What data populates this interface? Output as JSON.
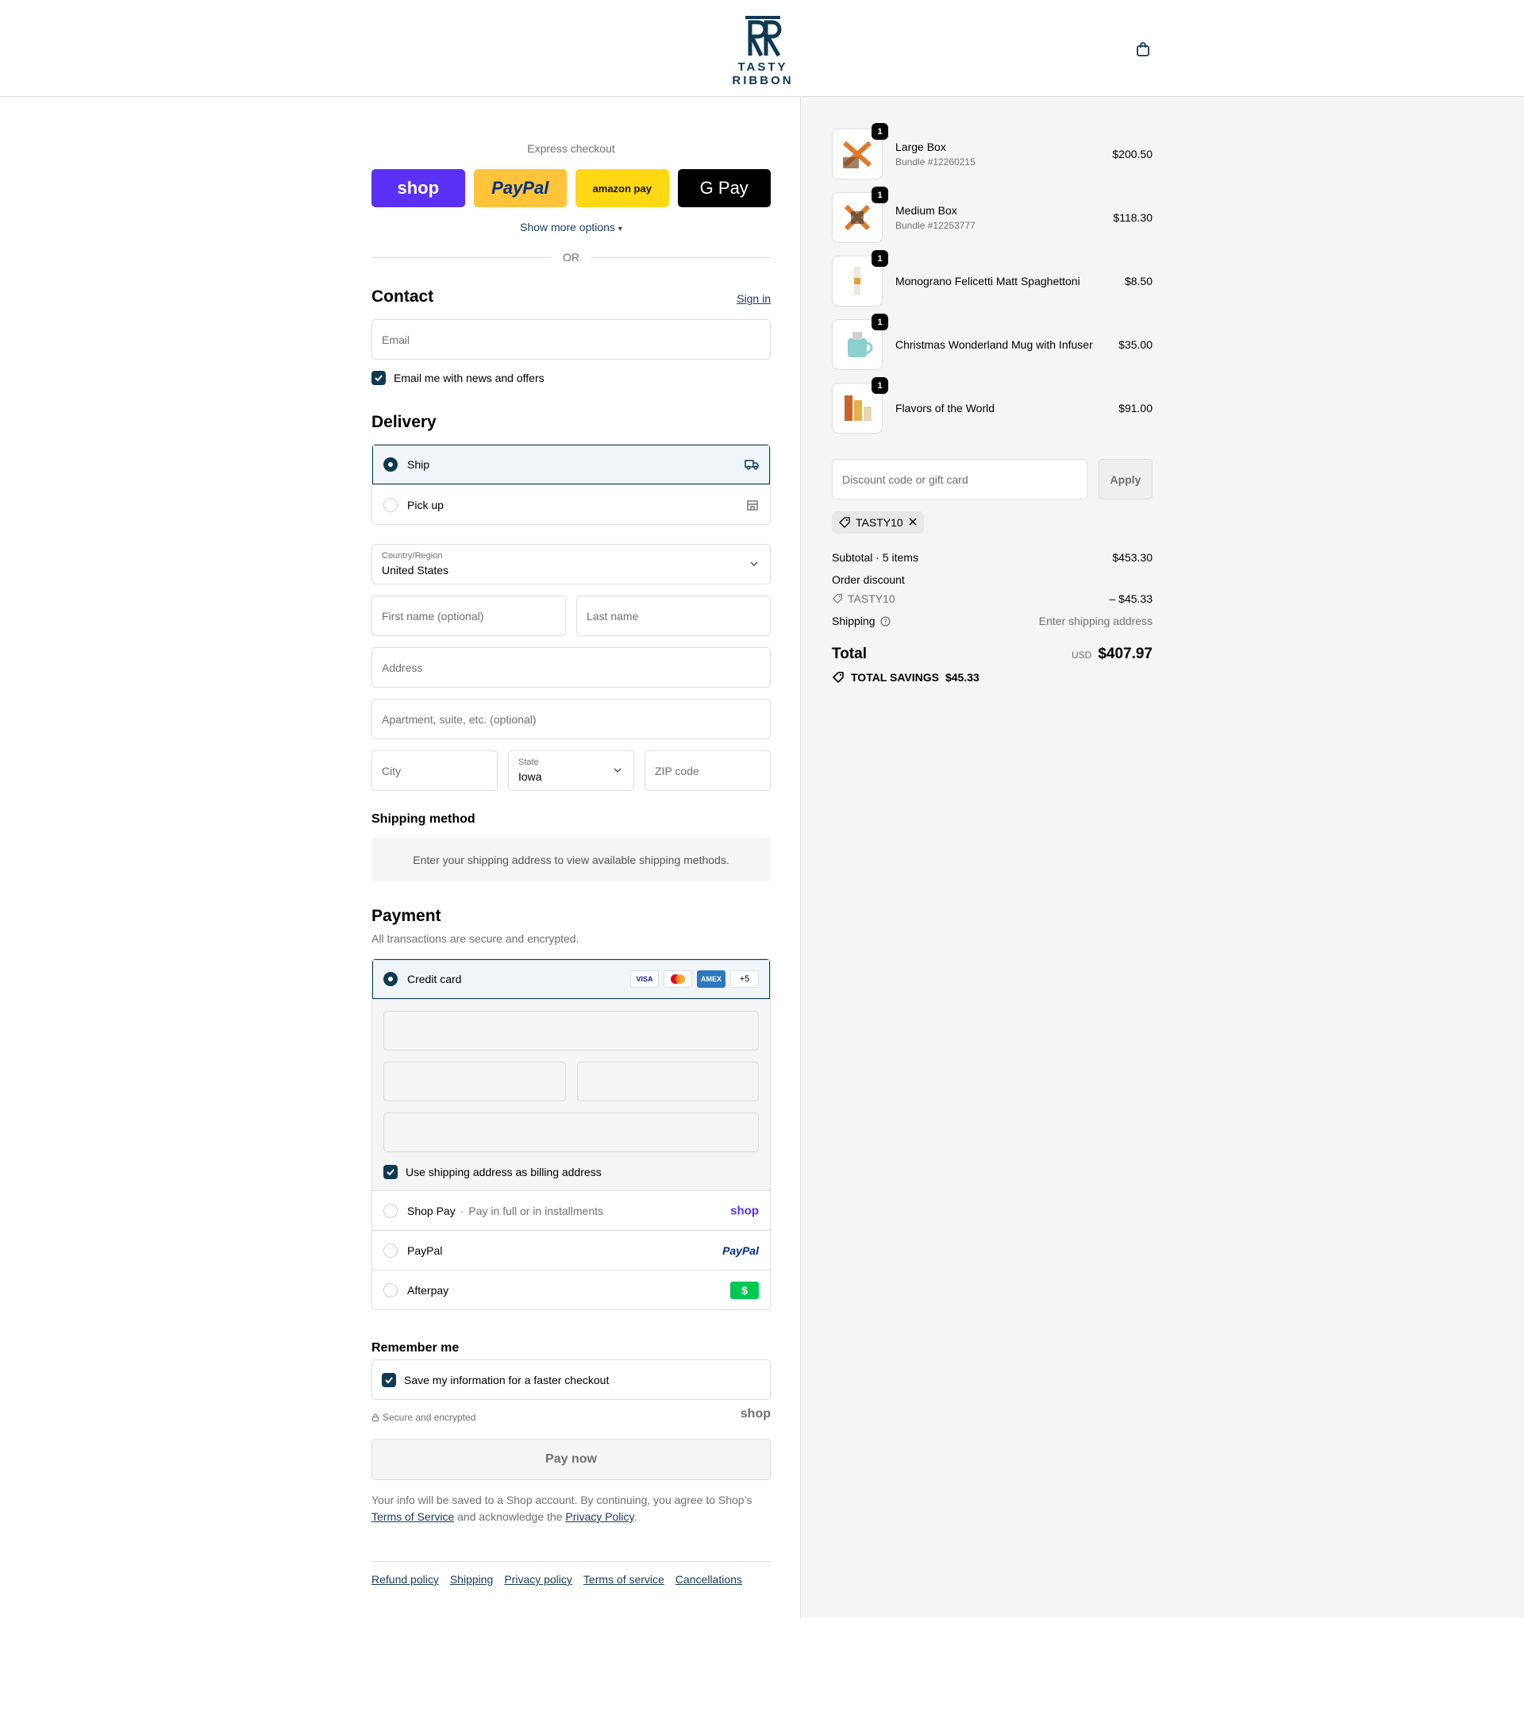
{
  "brand": {
    "name": "TASTY RIBBON"
  },
  "express": {
    "title": "Express checkout",
    "shop_label": "shop",
    "paypal_label": "PayPal",
    "amazon_label": "amazon pay",
    "gpay_label": "G Pay",
    "show_more": "Show more options",
    "or": "OR"
  },
  "contact": {
    "title": "Contact",
    "sign_in": "Sign in",
    "email_placeholder": "Email",
    "news_label": "Email me with news and offers"
  },
  "delivery": {
    "title": "Delivery",
    "ship_label": "Ship",
    "pickup_label": "Pick up",
    "country_label": "Country/Region",
    "country_value": "United States",
    "first_name_placeholder": "First name (optional)",
    "last_name_placeholder": "Last name",
    "address_placeholder": "Address",
    "apartment_placeholder": "Apartment, suite, etc. (optional)",
    "city_placeholder": "City",
    "state_label": "State",
    "state_value": "Iowa",
    "zip_placeholder": "ZIP code"
  },
  "shipping_method": {
    "title": "Shipping method",
    "info": "Enter your shipping address to view available shipping methods."
  },
  "payment": {
    "title": "Payment",
    "subtitle": "All transactions are secure and encrypted.",
    "credit_card_label": "Credit card",
    "card_brands": [
      "VISA",
      "MC",
      "AMEX"
    ],
    "more_cards": "+5",
    "billing_same_label": "Use shipping address as billing address",
    "shop_pay_label": "Shop Pay",
    "shop_pay_sub": "Pay in full or in installments",
    "shop_pay_logo": "shop",
    "paypal_label": "PayPal",
    "paypal_logo": "PayPal",
    "afterpay_label": "Afterpay"
  },
  "remember": {
    "title": "Remember me",
    "save_label": "Save my information for a faster checkout",
    "secure_label": "Secure and encrypted",
    "shop_logo": "shop"
  },
  "pay_now": "Pay now",
  "legal": {
    "text1": "Your info will be saved to a Shop account. By continuing, you agree to Shop’s",
    "terms": "Terms of Service",
    "text2": "and acknowledge the",
    "privacy": "Privacy Policy",
    "text3": "."
  },
  "footer_links": [
    "Refund policy",
    "Shipping",
    "Privacy policy",
    "Terms of service",
    "Cancellations"
  ],
  "cart_items": [
    {
      "name": "Large Box",
      "sub": "Bundle #12260215",
      "price": "$200.50",
      "qty": "1"
    },
    {
      "name": "Medium Box",
      "sub": "Bundle #12253777",
      "price": "$118.30",
      "qty": "1"
    },
    {
      "name": "Monograno Felicetti Matt Spaghettoni",
      "sub": "",
      "price": "$8.50",
      "qty": "1"
    },
    {
      "name": "Christmas Wonderland Mug with Infuser",
      "sub": "",
      "price": "$35.00",
      "qty": "1"
    },
    {
      "name": "Flavors of the World",
      "sub": "",
      "price": "$91.00",
      "qty": "1"
    }
  ],
  "discount": {
    "placeholder": "Discount code or gift card",
    "apply": "Apply",
    "applied_code": "TASTY10"
  },
  "totals": {
    "subtotal_label": "Subtotal · 5 items",
    "subtotal_value": "$453.30",
    "order_discount_label": "Order discount",
    "discount_code": "TASTY10",
    "discount_value": "– $45.33",
    "shipping_label": "Shipping",
    "shipping_value": "Enter shipping address",
    "total_label": "Total",
    "currency": "USD",
    "total_value": "$407.97",
    "savings_label": "TOTAL SAVINGS",
    "savings_value": "$45.33"
  },
  "colors": {
    "accent": "#0e3a52",
    "shop": "#5a31f4",
    "paypal": "#ffc439",
    "amazon": "#ffd814",
    "afterpay": "#00c853"
  }
}
